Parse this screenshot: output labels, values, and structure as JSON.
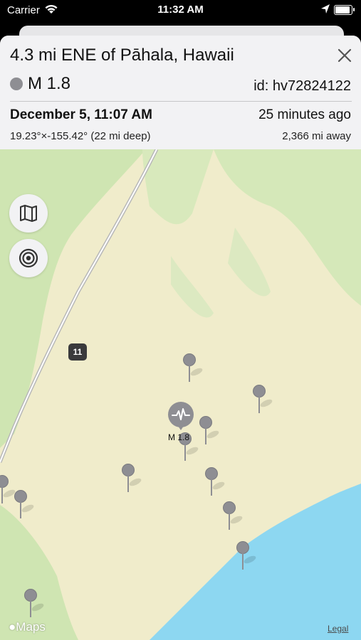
{
  "status_bar": {
    "carrier": "Carrier",
    "time": "11:32 AM",
    "battery_level": 0.9
  },
  "detail": {
    "title": "4.3 mi ENE of Pāhala, Hawaii",
    "magnitude": "M 1.8",
    "event_id": "id: hv72824122",
    "date": "December 5, 11:07 AM",
    "relative_time": "25 minutes ago",
    "coordinates": "19.23°×-155.42° (22 mi deep)",
    "distance": "2,366 mi away",
    "magnitude_color": "#8e8e93"
  },
  "map": {
    "road_number": "11",
    "selected_label": "M 1.8",
    "logo": "Maps",
    "legal": "Legal",
    "buttons": [
      "map-mode",
      "quake-focus"
    ]
  },
  "colors": {
    "land": "#f0eccb",
    "vegetation": "#cfe5b2",
    "ocean": "#8dd7f1"
  }
}
